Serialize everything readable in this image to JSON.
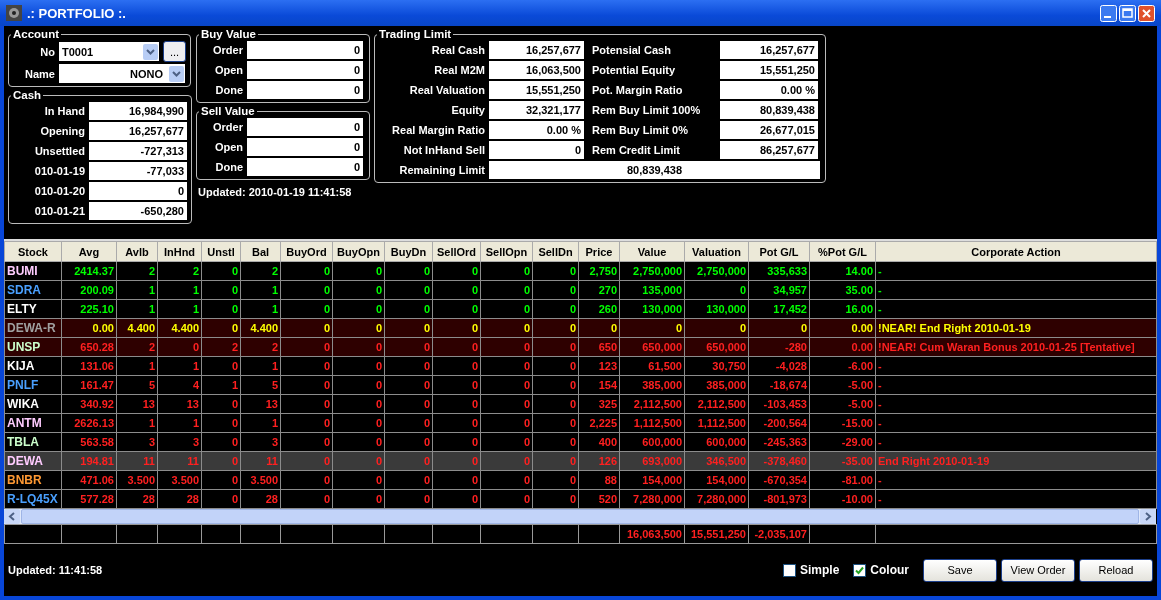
{
  "window": {
    "title": ".: PORTFOLIO :."
  },
  "account": {
    "title": "Account",
    "fields": [
      {
        "label": "No",
        "value": "T0001",
        "kind": "combo-browse",
        "browse": "..."
      },
      {
        "label": "Name",
        "value": "NONO",
        "kind": "combo"
      }
    ]
  },
  "cash": {
    "title": "Cash",
    "rows": [
      {
        "label": "In Hand",
        "value": "16,984,990"
      },
      {
        "label": "Opening",
        "value": "16,257,677"
      },
      {
        "label": "Unsettled",
        "value": "-727,313"
      },
      {
        "label": "010-01-19",
        "value": "-77,033"
      },
      {
        "label": "010-01-20",
        "value": "0"
      },
      {
        "label": "010-01-21",
        "value": "-650,280"
      }
    ]
  },
  "buy_value": {
    "title": "Buy Value",
    "rows": [
      {
        "label": "Order",
        "value": "0"
      },
      {
        "label": "Open",
        "value": "0"
      },
      {
        "label": "Done",
        "value": "0"
      }
    ]
  },
  "sell_value": {
    "title": "Sell Value",
    "rows": [
      {
        "label": "Order",
        "value": "0"
      },
      {
        "label": "Open",
        "value": "0"
      },
      {
        "label": "Done",
        "value": "0"
      }
    ]
  },
  "values_updated": "Updated: 2010-01-19 11:41:58",
  "trading_limit": {
    "title": "Trading Limit",
    "rows": [
      {
        "label": "Real Cash",
        "value": "16,257,677",
        "label2": "Potensial Cash",
        "value2": "16,257,677"
      },
      {
        "label": "Real M2M",
        "value": "16,063,500",
        "label2": "Potential Equity",
        "value2": "15,551,250"
      },
      {
        "label": "Real Valuation",
        "value": "15,551,250",
        "label2": "Pot. Margin Ratio",
        "value2": "0.00 %"
      },
      {
        "label": "Equity",
        "value": "32,321,177",
        "label2": "Rem Buy Limit 100%",
        "value2": "80,839,438"
      },
      {
        "label": "Real Margin Ratio",
        "value": "0.00 %",
        "label2": "Rem Buy Limit 0%",
        "value2": "26,677,015"
      },
      {
        "label": "Not InHand Sell",
        "value": "0",
        "label2": "Rem Credit Limit",
        "value2": "86,257,677"
      }
    ],
    "remaining": {
      "label": "Remaining Limit",
      "value": "80,839,438"
    }
  },
  "table": {
    "columns": [
      "Stock",
      "Avg",
      "Avlb",
      "InHnd",
      "Unstl",
      "Bal",
      "BuyOrd",
      "BuyOpn",
      "BuyDn",
      "SellOrd",
      "SellOpn",
      "SellDn",
      "Price",
      "Value",
      "Valuation",
      "Pot G/L",
      "%Pot G/L",
      "Corporate Action"
    ],
    "rows": [
      {
        "color": "#ffccff",
        "kind": "gain",
        "near": false,
        "selected": false,
        "cells": [
          "BUMI",
          "2414.37",
          "2",
          "2",
          "0",
          "2",
          "0",
          "0",
          "0",
          "0",
          "0",
          "0",
          "2,750",
          "2,750,000",
          "2,750,000",
          "335,633",
          "14.00",
          "-"
        ]
      },
      {
        "color": "#4aa0ff",
        "kind": "gain",
        "near": false,
        "selected": false,
        "cells": [
          "SDRA",
          "200.09",
          "1",
          "1",
          "0",
          "1",
          "0",
          "0",
          "0",
          "0",
          "0",
          "0",
          "270",
          "135,000",
          "0",
          "34,957",
          "35.00",
          "-"
        ]
      },
      {
        "color": "#ffffff",
        "kind": "gain",
        "near": false,
        "selected": false,
        "cells": [
          "ELTY",
          "225.10",
          "1",
          "1",
          "0",
          "1",
          "0",
          "0",
          "0",
          "0",
          "0",
          "0",
          "260",
          "130,000",
          "130,000",
          "17,452",
          "16.00",
          "-"
        ]
      },
      {
        "color": "#a0a0a0",
        "kind": "neutral",
        "near": true,
        "selected": false,
        "cells": [
          "DEWA-R",
          "0.00",
          "4.400",
          "4.400",
          "0",
          "4.400",
          "0",
          "0",
          "0",
          "0",
          "0",
          "0",
          "0",
          "0",
          "0",
          "0",
          "0.00",
          "!NEAR! End Right 2010-01-19"
        ]
      },
      {
        "color": "#ccffcc",
        "kind": "loss",
        "near": true,
        "selected": false,
        "cells": [
          "UNSP",
          "650.28",
          "2",
          "0",
          "2",
          "2",
          "0",
          "0",
          "0",
          "0",
          "0",
          "0",
          "650",
          "650,000",
          "650,000",
          "-280",
          "0.00",
          "!NEAR! Cum Waran Bonus 2010-01-25 [Tentative]"
        ]
      },
      {
        "color": "#ffffff",
        "kind": "loss",
        "near": false,
        "selected": false,
        "cells": [
          "KIJA",
          "131.06",
          "1",
          "1",
          "0",
          "1",
          "0",
          "0",
          "0",
          "0",
          "0",
          "0",
          "123",
          "61,500",
          "30,750",
          "-4,028",
          "-6.00",
          "-"
        ]
      },
      {
        "color": "#4aa0ff",
        "kind": "loss",
        "near": false,
        "selected": false,
        "cells": [
          "PNLF",
          "161.47",
          "5",
          "4",
          "1",
          "5",
          "0",
          "0",
          "0",
          "0",
          "0",
          "0",
          "154",
          "385,000",
          "385,000",
          "-18,674",
          "-5.00",
          "-"
        ]
      },
      {
        "color": "#ffffff",
        "kind": "loss",
        "near": false,
        "selected": false,
        "cells": [
          "WIKA",
          "340.92",
          "13",
          "13",
          "0",
          "13",
          "0",
          "0",
          "0",
          "0",
          "0",
          "0",
          "325",
          "2,112,500",
          "2,112,500",
          "-103,453",
          "-5.00",
          "-"
        ]
      },
      {
        "color": "#ffccff",
        "kind": "loss",
        "near": false,
        "selected": false,
        "cells": [
          "ANTM",
          "2626.13",
          "1",
          "1",
          "0",
          "1",
          "0",
          "0",
          "0",
          "0",
          "0",
          "0",
          "2,225",
          "1,112,500",
          "1,112,500",
          "-200,564",
          "-15.00",
          "-"
        ]
      },
      {
        "color": "#ccffcc",
        "kind": "loss",
        "near": false,
        "selected": false,
        "cells": [
          "TBLA",
          "563.58",
          "3",
          "3",
          "0",
          "3",
          "0",
          "0",
          "0",
          "0",
          "0",
          "0",
          "400",
          "600,000",
          "600,000",
          "-245,363",
          "-29.00",
          "-"
        ]
      },
      {
        "color": "#ffccff",
        "kind": "loss",
        "near": false,
        "selected": true,
        "cells": [
          "DEWA",
          "194.81",
          "11",
          "11",
          "0",
          "11",
          "0",
          "0",
          "0",
          "0",
          "0",
          "0",
          "126",
          "693,000",
          "346,500",
          "-378,460",
          "-35.00",
          "End Right 2010-01-19"
        ]
      },
      {
        "color": "#ff9933",
        "kind": "loss",
        "near": false,
        "selected": false,
        "cells": [
          "BNBR",
          "471.06",
          "3.500",
          "3.500",
          "0",
          "3.500",
          "0",
          "0",
          "0",
          "0",
          "0",
          "0",
          "88",
          "154,000",
          "154,000",
          "-670,354",
          "-81.00",
          "-"
        ]
      },
      {
        "color": "#4aa0ff",
        "kind": "loss",
        "near": false,
        "selected": false,
        "cells": [
          "R-LQ45X",
          "577.28",
          "28",
          "28",
          "0",
          "28",
          "0",
          "0",
          "0",
          "0",
          "0",
          "0",
          "520",
          "7,280,000",
          "7,280,000",
          "-801,973",
          "-10.00",
          "-"
        ]
      }
    ],
    "totals": {
      "value": "16,063,500",
      "valuation": "15,551,250",
      "pot_gl": "-2,035,107"
    }
  },
  "status_bar": {
    "updated": "Updated: 11:41:58",
    "checkboxes": [
      {
        "label": "Simple",
        "checked": false
      },
      {
        "label": "Colour",
        "checked": true
      }
    ],
    "buttons": [
      "Save",
      "View Order",
      "Reload"
    ]
  }
}
